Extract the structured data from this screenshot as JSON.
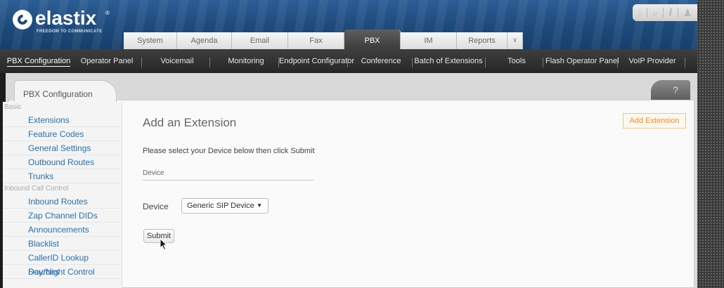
{
  "brand": {
    "name": "elastix",
    "reg": "®",
    "tagline": "FREEDOM TO COMMUNICATE"
  },
  "top_icons": [
    "drop-icon",
    "search-icon",
    "info-icon",
    "user-icon"
  ],
  "tabs": [
    {
      "label": "System"
    },
    {
      "label": "Agenda"
    },
    {
      "label": "Email"
    },
    {
      "label": "Fax"
    },
    {
      "label": "PBX",
      "active": true
    },
    {
      "label": "IM"
    },
    {
      "label": "Reports"
    },
    {
      "label": "∨"
    }
  ],
  "submenu": [
    {
      "label": "PBX Configuration",
      "active": true
    },
    {
      "label": "Operator Panel"
    },
    {
      "label": "Voicemail"
    },
    {
      "label": "Monitoring"
    },
    {
      "label": "Endpoint Configurator"
    },
    {
      "label": "Conference"
    },
    {
      "label": "Batch of Extensions"
    },
    {
      "label": "Tools"
    },
    {
      "label": "Flash Operator Panel"
    },
    {
      "label": "VoIP Provider"
    }
  ],
  "panel": {
    "tab_label": "PBX Configuration",
    "help_label": "?"
  },
  "sidebar": {
    "basic_label": "Basic",
    "basic": [
      "Extensions",
      "Feature Codes",
      "General Settings",
      "Outbound Routes",
      "Trunks"
    ],
    "inbound_label": "Inbound Call Control",
    "inbound": [
      "Inbound Routes",
      "Zap Channel DIDs",
      "Announcements",
      "Blacklist",
      "CallerID Lookup Sources",
      "Day/Night Control"
    ]
  },
  "main": {
    "title": "Add an Extension",
    "add_button": "Add Extension",
    "instructions": "Please select your Device below then click Submit",
    "section": "Device",
    "device_label": "Device",
    "device_value": "Generic SIP Device",
    "submit": "Submit"
  },
  "colors": {
    "brand_blue": "#1d4a7b",
    "link": "#2d6ea6",
    "accent_orange": "#e8902f"
  }
}
